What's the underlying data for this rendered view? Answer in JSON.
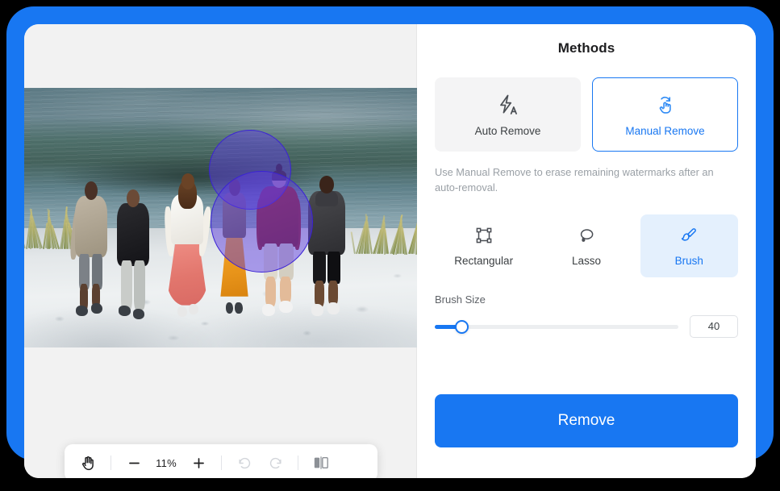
{
  "theme": {
    "accent": "#1877F2",
    "frame": "#1877F2",
    "panel_bg": "#FFFFFF",
    "canvas_bg": "#F2F2F2",
    "card_bg": "#F4F4F5",
    "selected_tool_bg": "#E4F0FD",
    "mask_fill": "#5F3CE1",
    "mask_stroke": "#3A22D6",
    "muted_text": "#9AA0A6"
  },
  "panel": {
    "title": "Methods",
    "hint": "Use Manual Remove to erase remaining watermarks after an auto-removal.",
    "methods": [
      {
        "id": "auto-remove",
        "label": "Auto Remove",
        "icon": "lightning-a-icon",
        "selected": false
      },
      {
        "id": "manual-remove",
        "label": "Manual Remove",
        "icon": "hand-touch-icon",
        "selected": true
      }
    ],
    "tools": [
      {
        "id": "rectangular",
        "label": "Rectangular",
        "icon": "rectangular-marquee-icon",
        "selected": false
      },
      {
        "id": "lasso",
        "label": "Lasso",
        "icon": "lasso-icon",
        "selected": false
      },
      {
        "id": "brush",
        "label": "Brush",
        "icon": "brush-icon",
        "selected": true
      }
    ],
    "brush_size": {
      "label": "Brush Size",
      "value": "40",
      "percent": 11
    },
    "primary_action": {
      "label": "Remove"
    }
  },
  "toolbar": {
    "pan_tool": "hand-icon",
    "zoom_out": "minus-icon",
    "zoom_level": "11%",
    "zoom_in": "plus-icon",
    "undo": "undo-icon",
    "redo": "redo-icon",
    "compare": "compare-split-icon",
    "undo_enabled": false,
    "redo_enabled": false
  },
  "canvas": {
    "image_description": "Six people walking away from camera across white sand toward a calm lake",
    "selection": {
      "type": "brush-mask",
      "blobs": 2,
      "subject": "person in orange dress"
    }
  }
}
